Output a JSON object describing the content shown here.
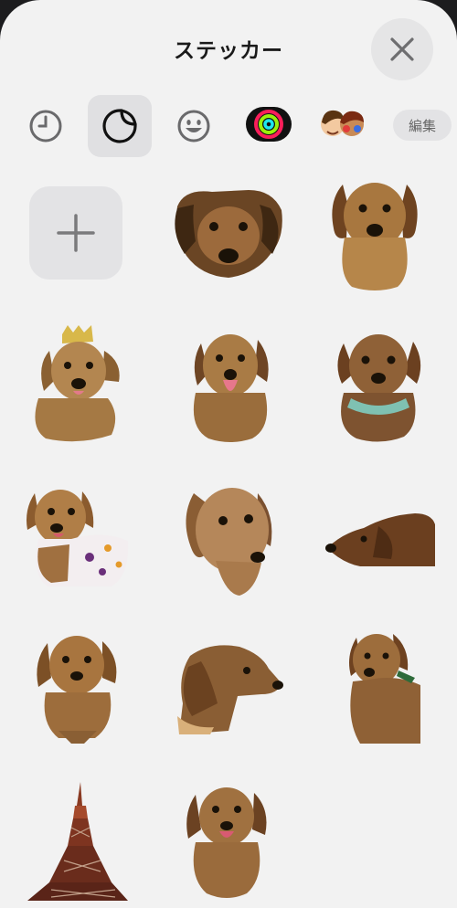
{
  "header": {
    "title": "ステッカー",
    "close_icon": "xmark-icon"
  },
  "tabs": [
    {
      "name": "recent",
      "icon": "clock-icon",
      "selected": false
    },
    {
      "name": "stickers",
      "icon": "sticker-peel-icon",
      "selected": true
    },
    {
      "name": "emoji",
      "icon": "smiley-icon",
      "selected": false
    },
    {
      "name": "activity",
      "icon": "activity-rings-icon",
      "selected": false
    },
    {
      "name": "memoji",
      "icon": "memoji-icon",
      "selected": false
    }
  ],
  "edit_label": "編集",
  "grid": {
    "add_button_icon": "plus-icon",
    "stickers": [
      {
        "subject": "dachshund-face-close"
      },
      {
        "subject": "dachshund-standing-front"
      },
      {
        "subject": "dachshund-with-crown"
      },
      {
        "subject": "dachshund-tongue-out"
      },
      {
        "subject": "dachshund-with-scarf"
      },
      {
        "subject": "dachshund-in-sweater"
      },
      {
        "subject": "dachshund-head-tilted"
      },
      {
        "subject": "dachshund-lying-profile"
      },
      {
        "subject": "dachshund-sitting-front"
      },
      {
        "subject": "dachshund-head-profile"
      },
      {
        "subject": "dachshund-looking-up"
      },
      {
        "subject": "tokyo-tower"
      },
      {
        "subject": "dachshund-smiling"
      }
    ]
  },
  "colors": {
    "background": "#f2f2f2",
    "button_fill": "#e3e3e5",
    "icon_gray": "#7a7a7c",
    "fur_light": "#b8895a",
    "fur_mid": "#8e6238",
    "fur_dark": "#5a3a1e",
    "tower_red": "#8a3a22"
  }
}
